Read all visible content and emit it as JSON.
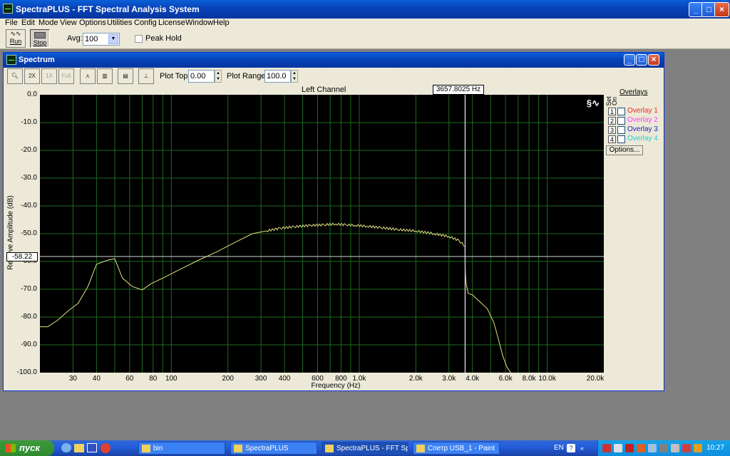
{
  "app": {
    "title": "SpectraPLUS - FFT Spectral Analysis System"
  },
  "menu": [
    "File",
    "Edit",
    "Mode",
    "View",
    "Options",
    "Utilities",
    "Config",
    "License",
    "Window",
    "Help"
  ],
  "toolbar": {
    "run_label": "Run",
    "stop_label": "Stop",
    "avg_label": "Avg:",
    "avg_value": "100",
    "peak_hold_label": "Peak Hold"
  },
  "spectrum": {
    "title": "Spectrum",
    "plot_top_label": "Plot Top:",
    "plot_top_value": "0.00",
    "plot_range_label": "Plot Range:",
    "plot_range_value": "100.0",
    "channel_label": "Left Channel",
    "cursor_readout": "3657.8025 Hz",
    "cursor_freq": 3657.8025,
    "level_readout": "-58.22",
    "level_value": -58.22,
    "overlays_header": "Overlays",
    "set_label": "Set",
    "on_label": "On",
    "overlays": [
      {
        "num": "1",
        "label": "Overlay 1",
        "color": "#ff2020",
        "checked": false
      },
      {
        "num": "2",
        "label": "Overlay 2",
        "color": "#ff40ff",
        "checked": false
      },
      {
        "num": "3",
        "label": "Overlay 3",
        "color": "#2020c0",
        "checked": false
      },
      {
        "num": "4",
        "label": "Overlay 4",
        "color": "#20d0d0",
        "checked": false
      }
    ],
    "options_label": "Options..."
  },
  "chart_data": {
    "type": "line",
    "title": "Left Channel",
    "xlabel": "Frequency (Hz)",
    "ylabel": "Relative Amplitude (dB)",
    "xscale": "log",
    "xlim": [
      20,
      20000
    ],
    "ylim": [
      -100,
      0
    ],
    "grid": true,
    "line_color": "#e0e080",
    "grid_color": "#1e6a1e",
    "background_color": "#000000",
    "y_ticks": [
      "0.0",
      "-10.0",
      "-20.0",
      "-30.0",
      "-40.0",
      "-50.0",
      "-60.0",
      "-70.0",
      "-80.0",
      "-90.0",
      "-100.0"
    ],
    "x_ticks": [
      {
        "v": 30,
        "label": "30"
      },
      {
        "v": 40,
        "label": "40"
      },
      {
        "v": 60,
        "label": "60"
      },
      {
        "v": 80,
        "label": "80"
      },
      {
        "v": 100,
        "label": "100"
      },
      {
        "v": 200,
        "label": "200"
      },
      {
        "v": 300,
        "label": "300"
      },
      {
        "v": 400,
        "label": "400"
      },
      {
        "v": 600,
        "label": "600"
      },
      {
        "v": 800,
        "label": "800"
      },
      {
        "v": 1000,
        "label": "1.0k"
      },
      {
        "v": 2000,
        "label": "2.0k"
      },
      {
        "v": 3000,
        "label": "3.0k"
      },
      {
        "v": 4000,
        "label": "4.0k"
      },
      {
        "v": 6000,
        "label": "6.0k"
      },
      {
        "v": 8000,
        "label": "8.0k"
      },
      {
        "v": 10000,
        "label": "10.0k"
      },
      {
        "v": 20000,
        "label": "20.0k"
      }
    ],
    "series": [
      {
        "x": [
          20,
          22,
          25,
          28,
          32,
          36,
          40,
          46,
          50,
          55,
          62,
          70,
          78,
          90,
          110,
          140,
          175,
          220,
          270,
          320,
          380,
          450,
          550,
          650,
          750,
          850,
          950,
          1100,
          1300,
          1600,
          2000,
          2500,
          3000,
          3400,
          3650,
          3660,
          3700,
          3800,
          4000,
          4300,
          4800,
          5200,
          5500,
          5800,
          6100,
          6400
        ],
        "y": [
          -83.5,
          -83.5,
          -81,
          -78,
          -75,
          -69,
          -61,
          -59.5,
          -59,
          -66,
          -69,
          -70.2,
          -68,
          -66,
          -63,
          -59.5,
          -56.5,
          -53,
          -50,
          -49,
          -48,
          -47.5,
          -47,
          -46.8,
          -46.5,
          -46.8,
          -47,
          -47.3,
          -47.8,
          -48.5,
          -49,
          -50,
          -51,
          -52.5,
          -54.5,
          -62,
          -68,
          -71.5,
          -72,
          -74,
          -77,
          -82,
          -88,
          -94,
          -98,
          -100
        ]
      }
    ]
  },
  "taskbar": {
    "start_label": "пуск",
    "tasks": [
      {
        "label": "bin",
        "active": false
      },
      {
        "label": "SpectraPLUS",
        "active": false
      },
      {
        "label": "SpectraPLUS - FFT Sp...",
        "active": true
      },
      {
        "label": "Спетр USB_1 - Paint",
        "active": false
      }
    ],
    "lang": "EN",
    "clock": "10:27"
  }
}
